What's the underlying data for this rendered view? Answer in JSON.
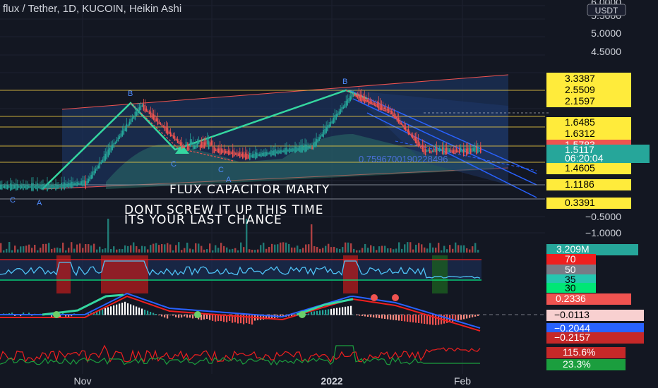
{
  "header": {
    "title": "flux / Tether, 1D, KUCOIN, Heikin Ashi",
    "currency_badge": "USDT"
  },
  "colors": {
    "background": "#131722",
    "up": "#26a69a",
    "down": "#ef5350",
    "level_yellow": "#f5d142",
    "channel_blue": "#2962ff",
    "channel_fill": "#1e3a6e",
    "teal_zigzag": "#35d7a0"
  },
  "chart_data": [
    {
      "type": "line",
      "name": "price-panel",
      "title": "flux / Tether, 1D, KUCOIN, Heikin Ashi",
      "scale": "log",
      "y_ticks": [
        "6.0000",
        "5.5000",
        "5.0000",
        "4.5000",
        "−0.5000",
        "−1.0000"
      ],
      "x_ticks": [
        "Nov",
        "2022",
        "Feb"
      ],
      "price_tags": [
        {
          "text": "3.3387",
          "style": "yellow"
        },
        {
          "text": "2.5509",
          "style": "yellow"
        },
        {
          "text": "2.1597",
          "style": "yellow"
        },
        {
          "text": "1.6485",
          "style": "yellow"
        },
        {
          "text": "1.6312",
          "style": "yellow"
        },
        {
          "text": "1.5783",
          "style": "red"
        },
        {
          "text": "1.5117",
          "style": "teal"
        },
        {
          "text": "06:20:04",
          "style": "teal-sub"
        },
        {
          "text": "1.4605",
          "style": "yellow"
        },
        {
          "text": "1.1186",
          "style": "yellow"
        },
        {
          "text": "0.3391",
          "style": "yellow"
        }
      ],
      "channel_label": "0.7596700190228496",
      "wave_labels": [
        "B",
        "C",
        "C",
        "A",
        "C",
        "A",
        "B"
      ],
      "annotations": [
        "FLUX CAPACITOR MARTY",
        "DONT SCREW IT UP THIS TIME",
        "ITS YOUR LAST CHANCE"
      ]
    },
    {
      "type": "bar",
      "name": "volume",
      "tag": "3.209M"
    },
    {
      "type": "line",
      "name": "rsi",
      "levels": [
        70,
        50,
        35,
        30
      ],
      "tags": [
        "70",
        "50",
        "35",
        "30"
      ]
    },
    {
      "type": "line",
      "name": "macd",
      "tags": [
        "0.2336",
        "−0.0113",
        "−0.2044",
        "−0.2157"
      ]
    },
    {
      "type": "line",
      "name": "oscillator",
      "tags": [
        "115.6%",
        "23.3%"
      ]
    }
  ]
}
